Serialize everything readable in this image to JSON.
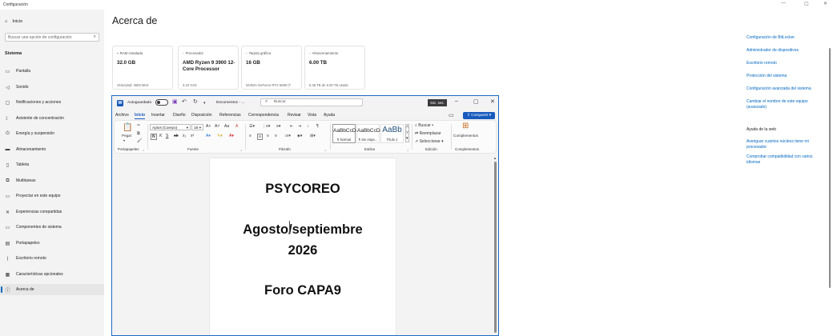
{
  "window": {
    "title": "Configuración",
    "controls": [
      "—",
      "▢",
      "✕"
    ]
  },
  "sidebar": {
    "home_label": "Inicio",
    "search_placeholder": "Buscar una opción de configuración",
    "section": "Sistema",
    "items": [
      {
        "label": "Pantalla",
        "icon": "display-icon"
      },
      {
        "label": "Sonido",
        "icon": "speaker-icon"
      },
      {
        "label": "Notificaciones y acciones",
        "icon": "notification-icon"
      },
      {
        "label": "Asistente de concentración",
        "icon": "moon-icon"
      },
      {
        "label": "Energía y suspensión",
        "icon": "power-icon"
      },
      {
        "label": "Almacenamiento",
        "icon": "storage-icon"
      },
      {
        "label": "Tableta",
        "icon": "tablet-icon"
      },
      {
        "label": "Multitareas",
        "icon": "multitask-icon"
      },
      {
        "label": "Proyectar en este equipo",
        "icon": "project-icon"
      },
      {
        "label": "Experiencias compartidas",
        "icon": "share-icon"
      },
      {
        "label": "Componentes de sistema",
        "icon": "components-icon"
      },
      {
        "label": "Portapapeles",
        "icon": "clipboard-icon"
      },
      {
        "label": "Escritorio remoto",
        "icon": "remote-icon"
      },
      {
        "label": "Características opcionales",
        "icon": "features-icon"
      },
      {
        "label": "Acerca de",
        "icon": "info-icon",
        "active": true
      }
    ]
  },
  "main": {
    "title": "Acerca de",
    "cards": [
      {
        "label": "RAM instalada",
        "value": "32.0 GB",
        "sub": "Velocidad: 3600 MHz"
      },
      {
        "label": "Procesador",
        "value": "AMD Ryzen 9 3900 12-Core Processor",
        "sub": "3.10 GHz"
      },
      {
        "label": "Tarjeta gráfica",
        "value": "16 GB",
        "sub": "NVIDIA GeForce RTX 5080 (T"
      },
      {
        "label": "Almacenamiento",
        "value": "6.00 TB",
        "sub": "5.45 TB de 6.00 TB usado"
      }
    ]
  },
  "related": {
    "links": [
      "Configuración de BitLocker",
      "Administrador de dispositivos",
      "Escritorio remoto",
      "Protección del sistema",
      "Configuración avanzada del sistema",
      "Cambiar el nombre de este equipo (avanzado)"
    ],
    "help_heading": "Ayuda de la web",
    "help_links": [
      "Averiguar cuántos núcleos tiene mi procesador",
      "Comprobar compatibilidad con varios idiomas"
    ]
  },
  "word": {
    "autosave_label": "Autoguardado",
    "doc_name": "Documento1 - ...",
    "search_placeholder": "Buscar",
    "signin": "Inic. ses.",
    "tabs": [
      "Archivo",
      "Inicio",
      "Insertar",
      "Diseño",
      "Disposición",
      "Referencias",
      "Correspondencia",
      "Revisar",
      "Vista",
      "Ayuda"
    ],
    "active_tab": "Inicio",
    "share_label": "Compartir",
    "ribbon": {
      "paste_label": "Pegar",
      "font_name": "Aptos (Cuerpo)",
      "font_size": "18",
      "styles": [
        {
          "sample": "AaBbCcDd",
          "name": "¶ Normal"
        },
        {
          "sample": "AaBbCcDd",
          "name": "¶ Sin espa..."
        },
        {
          "sample": "AaBb",
          "name": "Título 1"
        }
      ],
      "find_label": "Buscar",
      "replace_label": "Reemplazar",
      "select_label": "Seleccionar",
      "addins_label": "Complementos",
      "groups": [
        "Portapapeles",
        "Fuente",
        "Párrafo",
        "Estilos",
        "Edición",
        "Complementos"
      ]
    },
    "document": {
      "lines": [
        "PSYCOREO",
        "Agosto/septiembre",
        "2026",
        "Foro CAPA9"
      ]
    }
  }
}
